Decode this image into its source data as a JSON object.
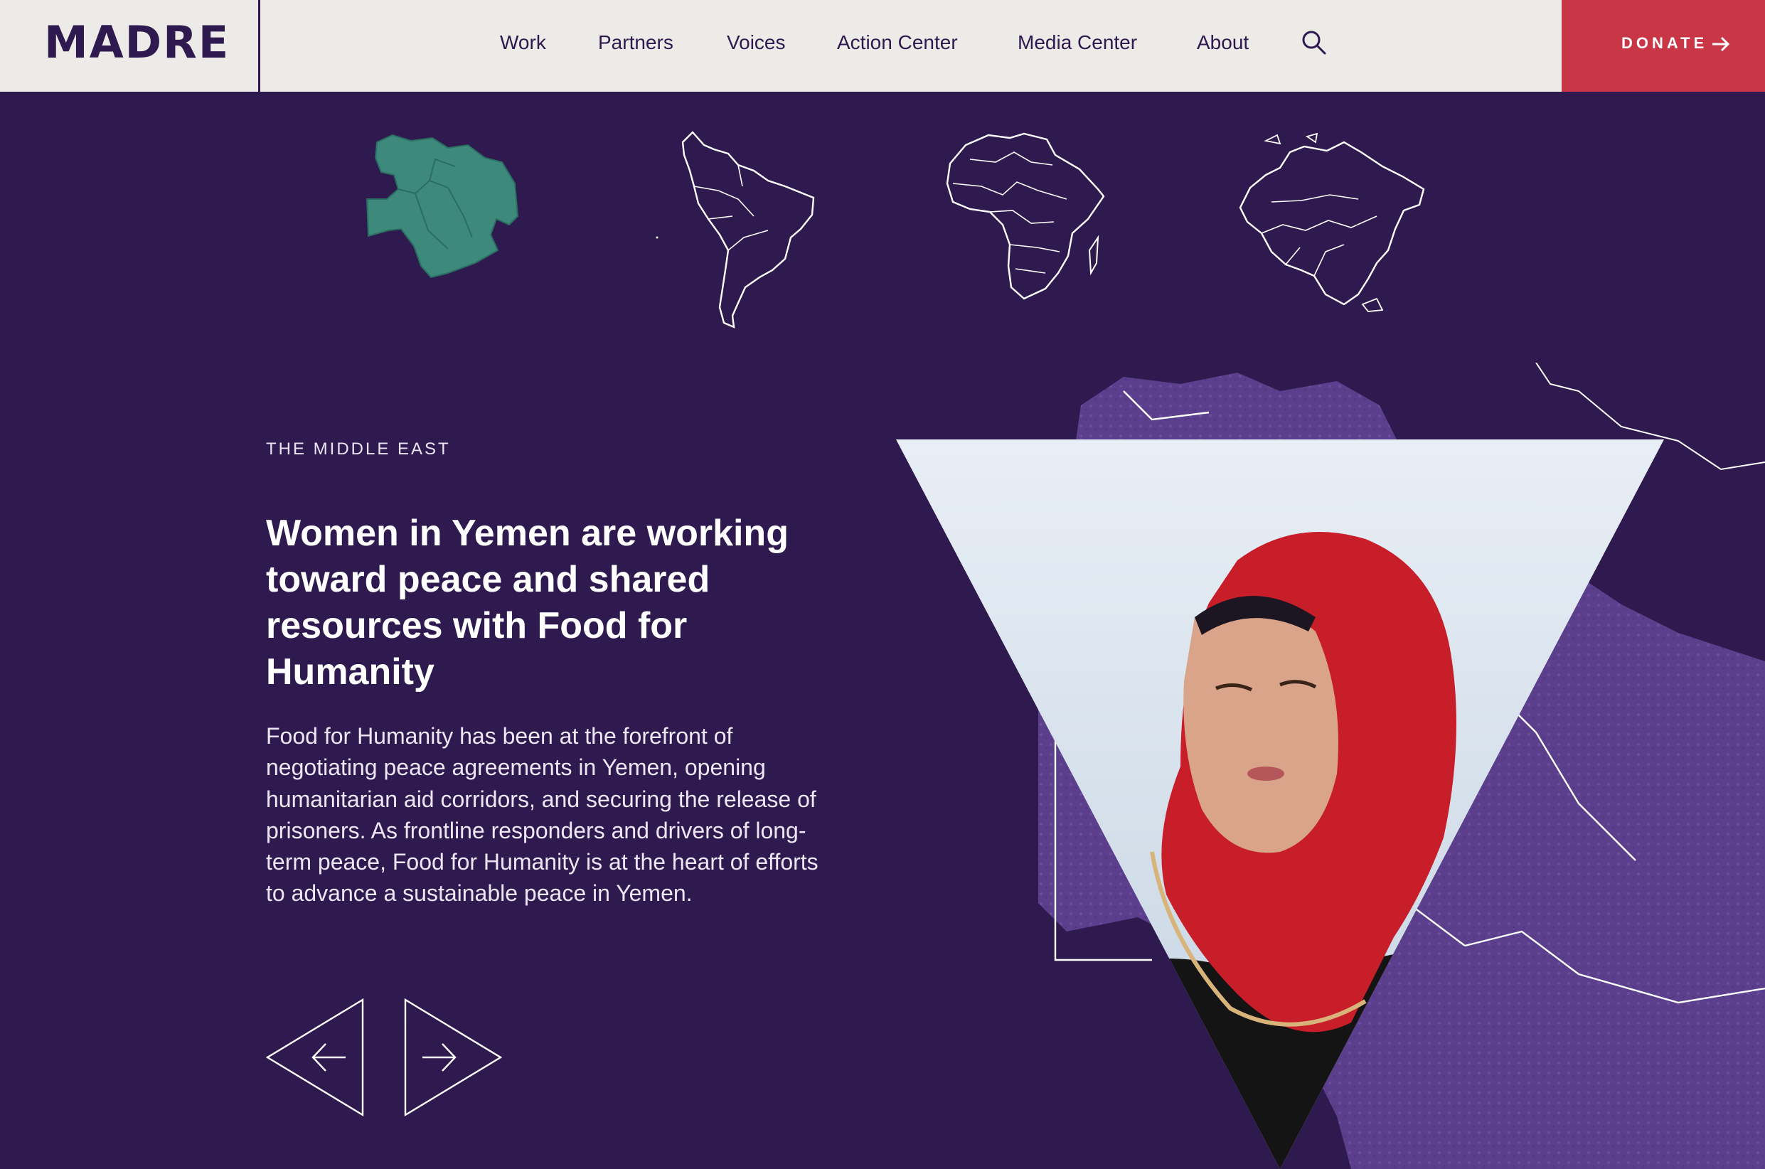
{
  "header": {
    "logo": "MADRE",
    "nav": [
      {
        "label": "Work"
      },
      {
        "label": "Partners"
      },
      {
        "label": "Voices"
      },
      {
        "label": "Action Center"
      },
      {
        "label": "Media Center"
      },
      {
        "label": "About"
      }
    ],
    "search_icon": "search-icon",
    "donate": {
      "label": "DONATE",
      "icon": "arrow-right-icon"
    }
  },
  "regions": [
    {
      "name": "middle-east",
      "selected": true
    },
    {
      "name": "latin-america",
      "selected": false
    },
    {
      "name": "africa",
      "selected": false
    },
    {
      "name": "asia",
      "selected": false
    }
  ],
  "feature": {
    "eyebrow": "THE MIDDLE EAST",
    "headline": "Women in Yemen are working toward peace and shared resources with Food for Humanity",
    "body": "Food for Humanity has been at the forefront of negotiating peace agreements in Yemen, opening humanitarian aid corridors, and securing the release of prisoners. As frontline responders and drivers of long-term peace, Food for Humanity is at the heart of efforts to advance a sustainable peace in Yemen."
  },
  "carousel": {
    "prev_icon": "arrow-left-icon",
    "next_icon": "arrow-right-icon"
  },
  "colors": {
    "background": "#2e1a4f",
    "header_bg": "#ecebe7",
    "donate_bg": "#c93645",
    "selected_region": "#3d8a7c",
    "map_fill": "#5c3f8c"
  }
}
